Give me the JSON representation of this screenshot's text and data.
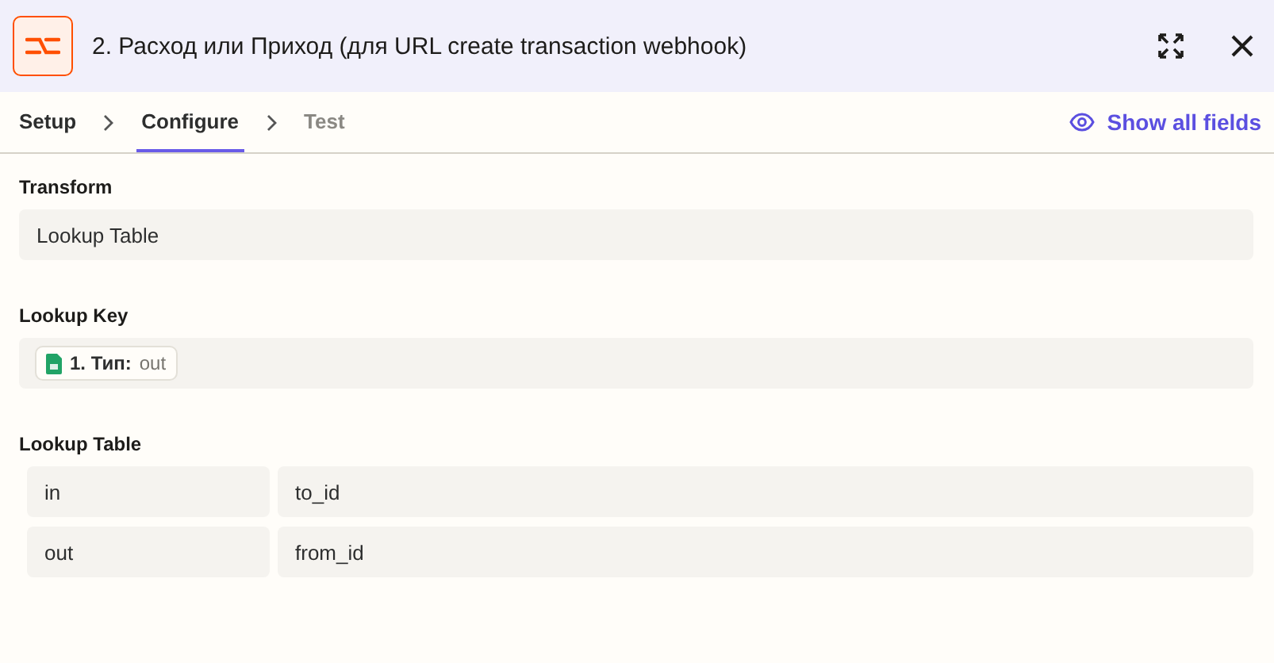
{
  "header": {
    "title": "2. Расход или Приход (для URL create transaction webhook)"
  },
  "tabs": [
    {
      "label": "Setup",
      "selected": false,
      "disabled": false
    },
    {
      "label": "Configure",
      "selected": true,
      "disabled": false
    },
    {
      "label": "Test",
      "selected": false,
      "disabled": true
    }
  ],
  "show_all_fields": "Show all fields",
  "transform": {
    "label": "Transform",
    "value": "Lookup Table"
  },
  "lookup_key": {
    "label": "Lookup Key",
    "pill": {
      "step": "1. Тип:",
      "value": "out"
    }
  },
  "lookup_table": {
    "label": "Lookup Table",
    "rows": [
      {
        "key": "in",
        "value": "to_id"
      },
      {
        "key": "out",
        "value": "from_id"
      }
    ]
  }
}
